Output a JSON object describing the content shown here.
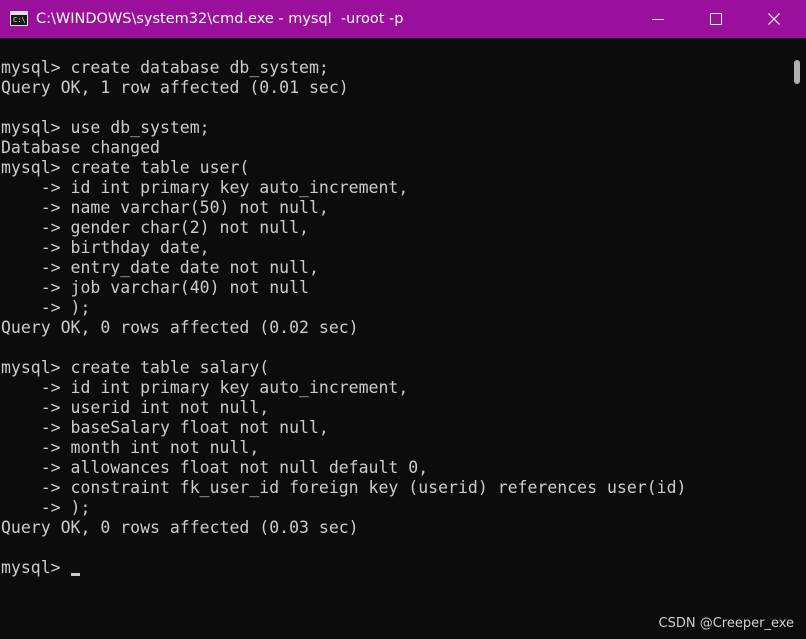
{
  "window": {
    "title": "C:\\WINDOWS\\system32\\cmd.exe - mysql  -uroot -p",
    "accent_color": "#9a0f9c",
    "icon": "console-app-icon",
    "icon_text": "C:\\",
    "controls": [
      "minimize-icon",
      "maximize-icon",
      "close-icon"
    ]
  },
  "console": {
    "background": "#0c0c0c",
    "foreground": "#cccccc",
    "lines": [
      "mysql> create database db_system;",
      "Query OK, 1 row affected (0.01 sec)",
      "",
      "mysql> use db_system;",
      "Database changed",
      "mysql> create table user(",
      "    -> id int primary key auto_increment,",
      "    -> name varchar(50) not null,",
      "    -> gender char(2) not null,",
      "    -> birthday date,",
      "    -> entry_date date not null,",
      "    -> job varchar(40) not null",
      "    -> );",
      "Query OK, 0 rows affected (0.02 sec)",
      "",
      "mysql> create table salary(",
      "    -> id int primary key auto_increment,",
      "    -> userid int not null,",
      "    -> baseSalary float not null,",
      "    -> month int not null,",
      "    -> allowances float not null default 0,",
      "    -> constraint fk_user_id foreign key (userid) references user(id)",
      "    -> );",
      "Query OK, 0 rows affected (0.03 sec)",
      "",
      "mysql> "
    ]
  },
  "watermark": "CSDN @Creeper_exe"
}
